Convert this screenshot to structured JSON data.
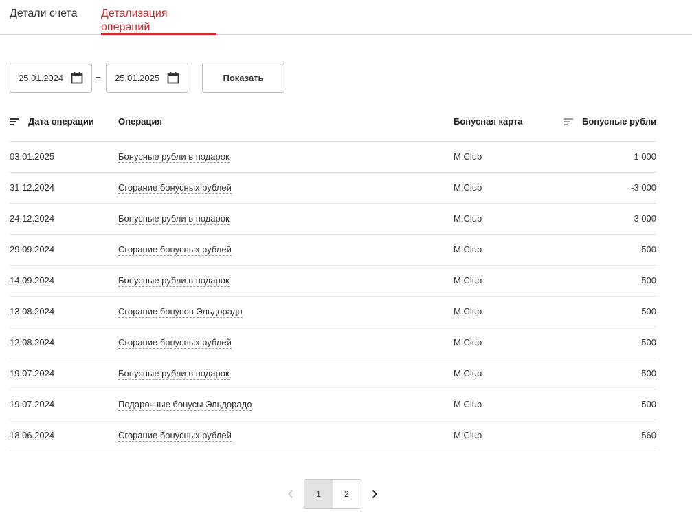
{
  "tabs": [
    {
      "label": "Детали счета",
      "active": false
    },
    {
      "label": "Детализация операций",
      "active": true
    }
  ],
  "filter": {
    "date_from": "25.01.2024",
    "date_to": "25.01.2025",
    "separator": "–",
    "show_label": "Показать"
  },
  "table": {
    "headers": {
      "date": "Дата операции",
      "operation": "Операция",
      "card": "Бонусная карта",
      "amount": "Бонусные рубли"
    },
    "rows": [
      {
        "date": "03.01.2025",
        "operation": "Бонусные рубли в подарок",
        "card": "M.Club",
        "amount": "1 000"
      },
      {
        "date": "31.12.2024",
        "operation": "Сгорание бонусных рублей",
        "card": "M.Club",
        "amount": "-3 000"
      },
      {
        "date": "24.12.2024",
        "operation": "Бонусные рубли в подарок",
        "card": "M.Club",
        "amount": "3 000"
      },
      {
        "date": "29.09.2024",
        "operation": "Сгорание бонусных рублей",
        "card": "M.Club",
        "amount": "-500"
      },
      {
        "date": "14.09.2024",
        "operation": "Бонусные рубли в подарок",
        "card": "M.Club",
        "amount": "500"
      },
      {
        "date": "13.08.2024",
        "operation": "Сгорание бонусов Эльдорадо",
        "card": "M.Club",
        "amount": "500"
      },
      {
        "date": "12.08.2024",
        "operation": "Сгорание бонусных рублей",
        "card": "M.Club",
        "amount": "-500"
      },
      {
        "date": "19.07.2024",
        "operation": "Бонусные рубли в подарок",
        "card": "M.Club",
        "amount": "500"
      },
      {
        "date": "19.07.2024",
        "operation": "Подарочные бонусы Эльдорадо",
        "card": "M.Club",
        "amount": "500"
      },
      {
        "date": "18.06.2024",
        "operation": "Сгорание бонусных рублей",
        "card": "M.Club",
        "amount": "-560"
      }
    ]
  },
  "pagination": {
    "pages": [
      "1",
      "2"
    ],
    "current": "1",
    "prev_icon": "chevron-left-icon",
    "next_icon": "chevron-right-icon"
  },
  "colors": {
    "accent": "#d7262c",
    "border": "#bdbdbd",
    "divider": "#e6e6e6"
  }
}
